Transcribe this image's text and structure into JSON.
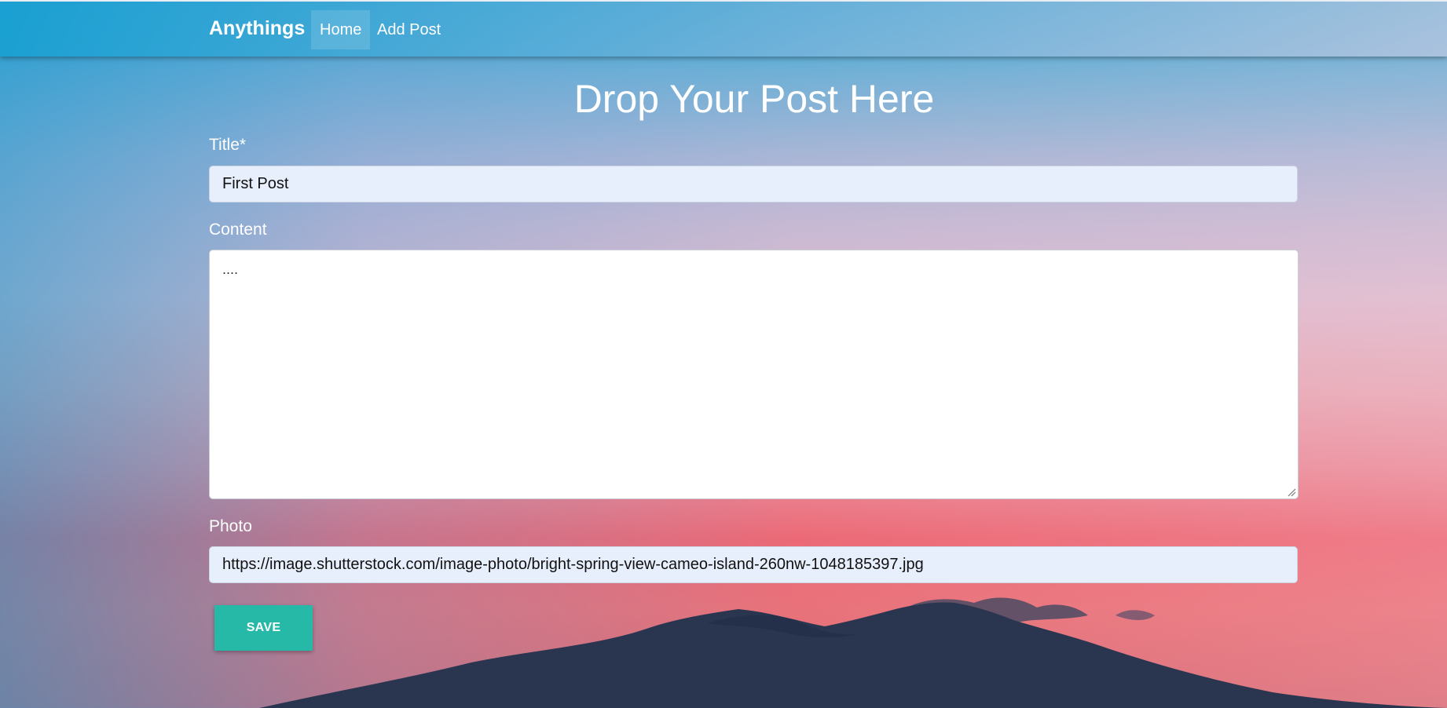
{
  "navbar": {
    "brand": "Anythings",
    "items": [
      {
        "label": "Home"
      },
      {
        "label": "Add Post"
      }
    ]
  },
  "page": {
    "heading": "Drop Your Post Here"
  },
  "form": {
    "title": {
      "label": "Title*",
      "value": "First Post"
    },
    "content": {
      "label": "Content",
      "value": "...."
    },
    "photo": {
      "label": "Photo",
      "value": "https://image.shutterstock.com/image-photo/bright-spring-view-cameo-island-260nw-1048185397.jpg"
    },
    "save_label": "SAVE"
  },
  "colors": {
    "save_button": "#26b9a8",
    "input_background": "#e8effc"
  }
}
